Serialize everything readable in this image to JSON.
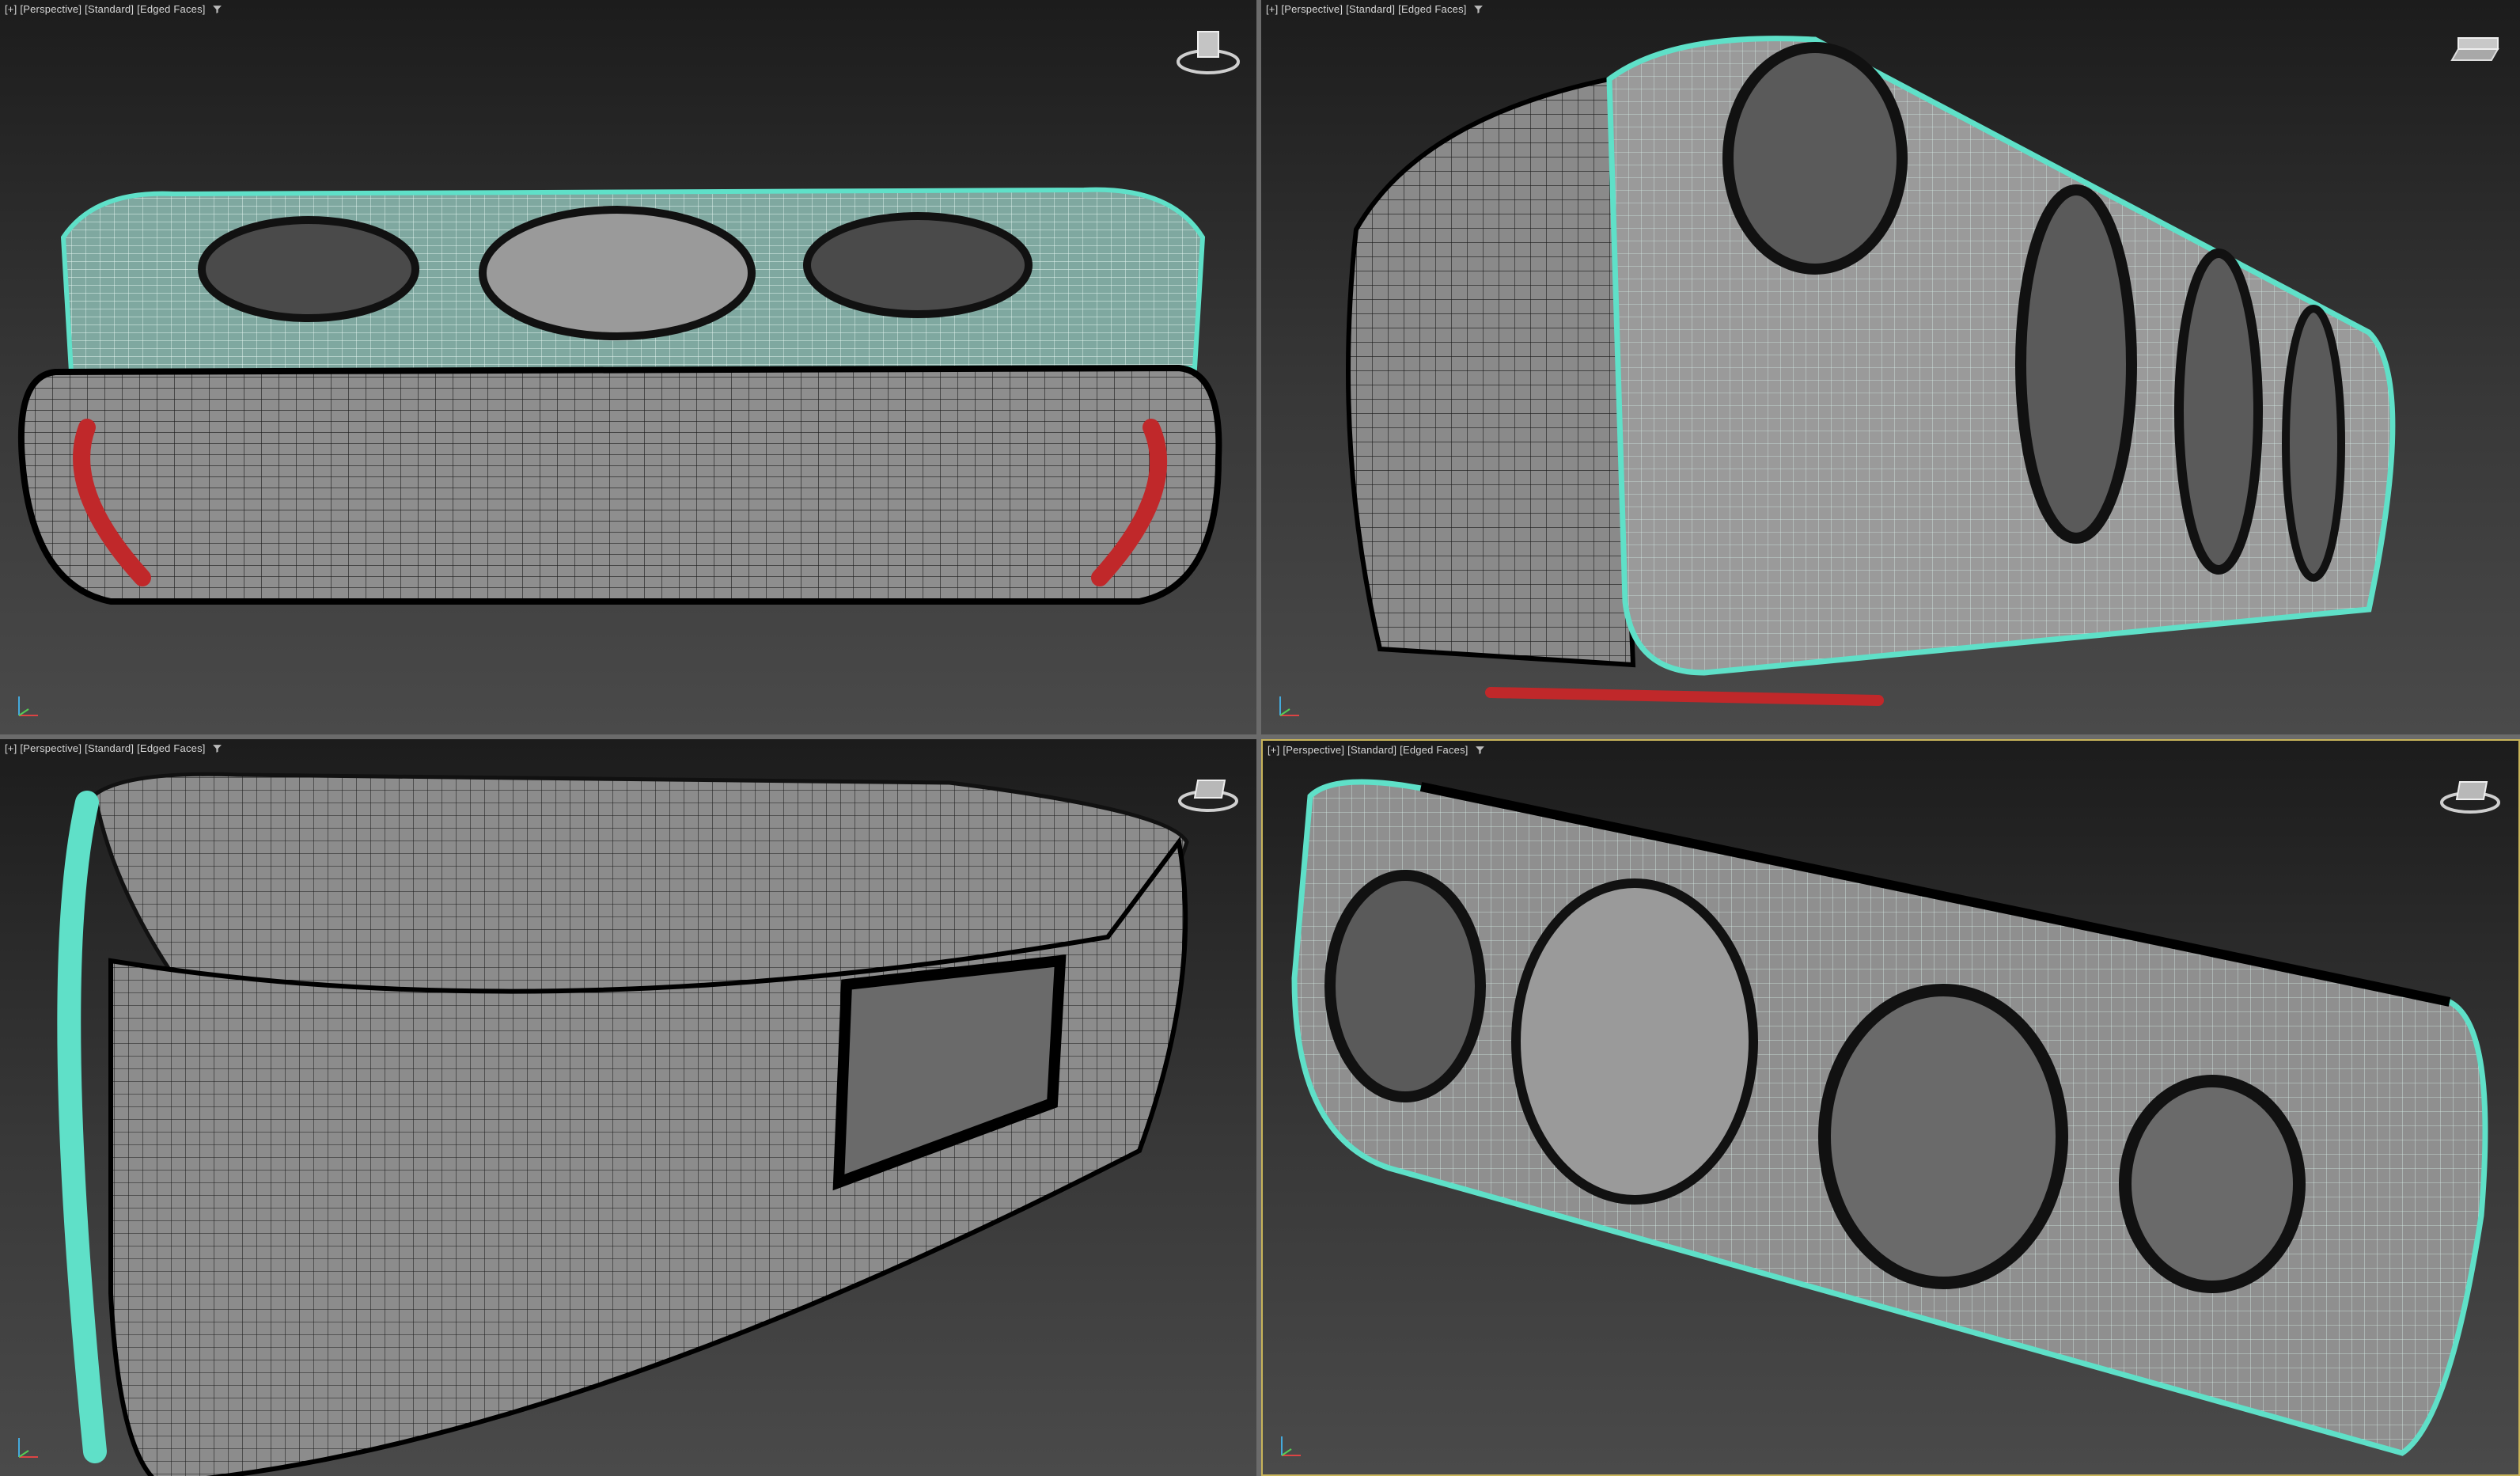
{
  "viewports": [
    {
      "id": "top-left",
      "labels": {
        "plus": "[+]",
        "view": "[Perspective]",
        "shading": "[Standard]",
        "display": "[Edged Faces]"
      },
      "viewcube_icon": "viewcube-icon",
      "active": false
    },
    {
      "id": "top-right",
      "labels": {
        "plus": "[+]",
        "view": "[Perspective]",
        "shading": "[Standard]",
        "display": "[Edged Faces]"
      },
      "viewcube_icon": "viewcube-icon",
      "active": false
    },
    {
      "id": "bottom-left",
      "labels": {
        "plus": "[+]",
        "view": "[Perspective]",
        "shading": "[Standard]",
        "display": "[Edged Faces]"
      },
      "viewcube_icon": "viewcube-icon",
      "active": false
    },
    {
      "id": "bottom-right",
      "labels": {
        "plus": "[+]",
        "view": "[Perspective]",
        "shading": "[Standard]",
        "display": "[Edged Faces]"
      },
      "viewcube_icon": "viewcube-icon",
      "active": true
    }
  ],
  "colors": {
    "viewport_bg_top": "#1c1c1c",
    "viewport_bg_bottom": "#4a4a4a",
    "mesh_fill": "#8a8a8a",
    "wire": "#1a1a1a",
    "selection_edge": "#5fe0c8",
    "accent_red": "#c0282a",
    "active_border": "#c8b45a"
  }
}
